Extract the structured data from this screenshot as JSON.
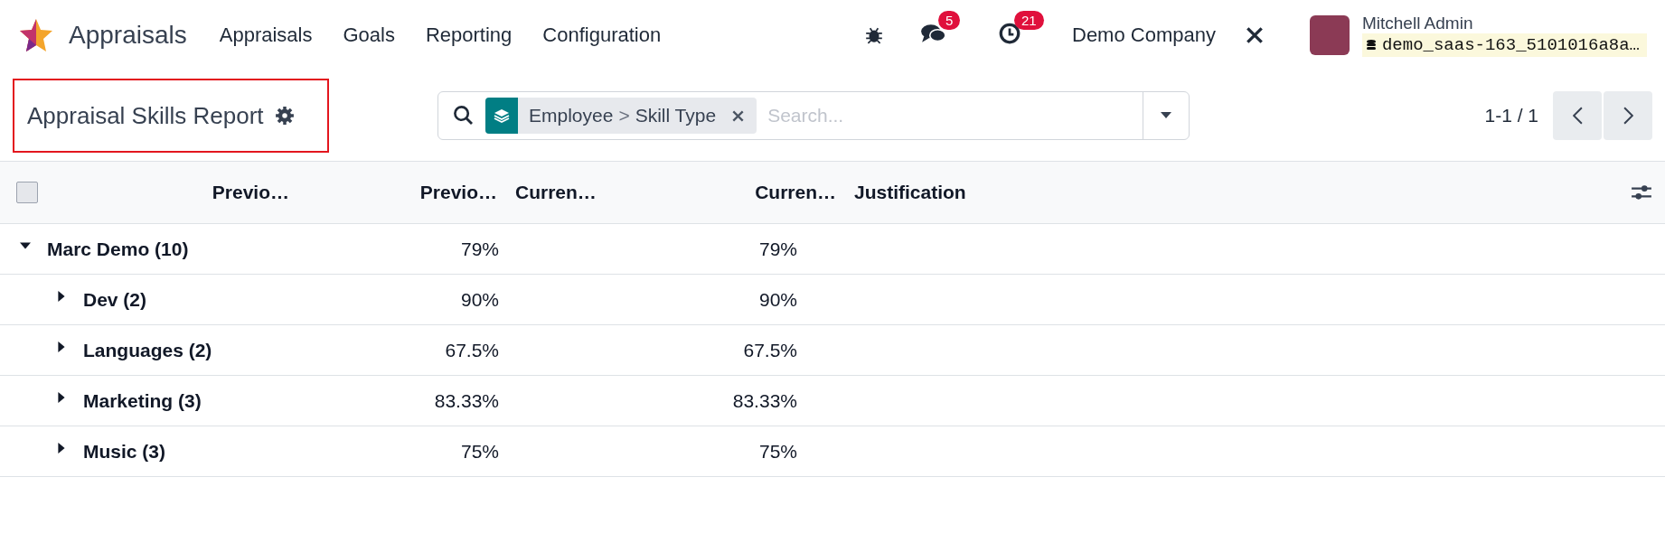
{
  "navbar": {
    "app_name": "Appraisals",
    "menu": [
      "Appraisals",
      "Goals",
      "Reporting",
      "Configuration"
    ],
    "messages_badge": "5",
    "activities_badge": "21",
    "company": "Demo Company",
    "user_name": "Mitchell Admin",
    "database": "demo_saas-163_5101016a8a…"
  },
  "control_panel": {
    "title": "Appraisal Skills Report",
    "facet": {
      "field": "Employee",
      "separator": ">",
      "value": "Skill Type"
    },
    "search_placeholder": "Search...",
    "pager": "1-1 / 1"
  },
  "table": {
    "select_all": {
      "checked": false
    },
    "columns": [
      "Previo…",
      "Previo…",
      "Curren…",
      "Curren…",
      "Justification"
    ],
    "groups": [
      {
        "label": "Marc Demo (10)",
        "previous": "79%",
        "current": "79%",
        "expanded": true,
        "children": [
          {
            "label": "Dev (2)",
            "previous": "90%",
            "current": "90%",
            "expanded": false
          },
          {
            "label": "Languages (2)",
            "previous": "67.5%",
            "current": "67.5%",
            "expanded": false
          },
          {
            "label": "Marketing (3)",
            "previous": "83.33%",
            "current": "83.33%",
            "expanded": false
          },
          {
            "label": "Music (3)",
            "previous": "75%",
            "current": "75%",
            "expanded": false
          }
        ]
      }
    ]
  }
}
